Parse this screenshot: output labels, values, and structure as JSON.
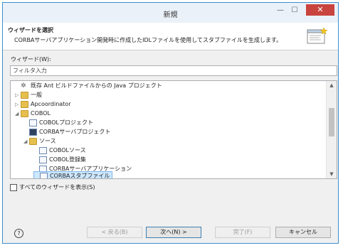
{
  "window": {
    "title": "新規",
    "minimize": "—",
    "maximize": "☐",
    "close": "✕"
  },
  "banner": {
    "title": "ウィザードを選択",
    "description": "CORBAサーバアプリケーション開発時に作成したIDLファイルを使用してスタブファイルを生成します。"
  },
  "wizards_label": "ウィザード(W):",
  "filter": {
    "value": "フィルタ入力"
  },
  "tree": {
    "items": [
      {
        "label": "既存 Ant ビルドファイルからの Java プロジェクト",
        "twisty": "",
        "icon": "gear-icon"
      },
      {
        "label": "一般",
        "twisty": "▷",
        "icon": "folder-icon"
      },
      {
        "label": "Apcoordinator",
        "twisty": "▷",
        "icon": "folder-icon"
      },
      {
        "label": "COBOL",
        "twisty": "◢",
        "icon": "folder-icon"
      },
      {
        "label": "COBOLプロジェクト",
        "twisty": "",
        "icon": "project-icon"
      },
      {
        "label": "CORBAサーバプロジェクト",
        "twisty": "",
        "icon": "project-icon"
      },
      {
        "label": "ソース",
        "twisty": "◢",
        "icon": "folder-icon"
      },
      {
        "label": "COBOLソース",
        "twisty": "",
        "icon": "file-icon"
      },
      {
        "label": "COBOL登録集",
        "twisty": "",
        "icon": "file-icon"
      },
      {
        "label": "CORBAサーバアプリケーション",
        "twisty": "",
        "icon": "file-icon"
      },
      {
        "label": "CORBAスタブファイル",
        "twisty": "",
        "icon": "file-icon",
        "selected": true
      }
    ]
  },
  "show_all": {
    "label": "すべてのウィザードを表示(S)",
    "checked": false
  },
  "buttons": {
    "help": "?",
    "back": "< 戻る(B)",
    "next": "次へ(N) >",
    "finish": "完了(F)",
    "cancel": "キャンセル"
  }
}
